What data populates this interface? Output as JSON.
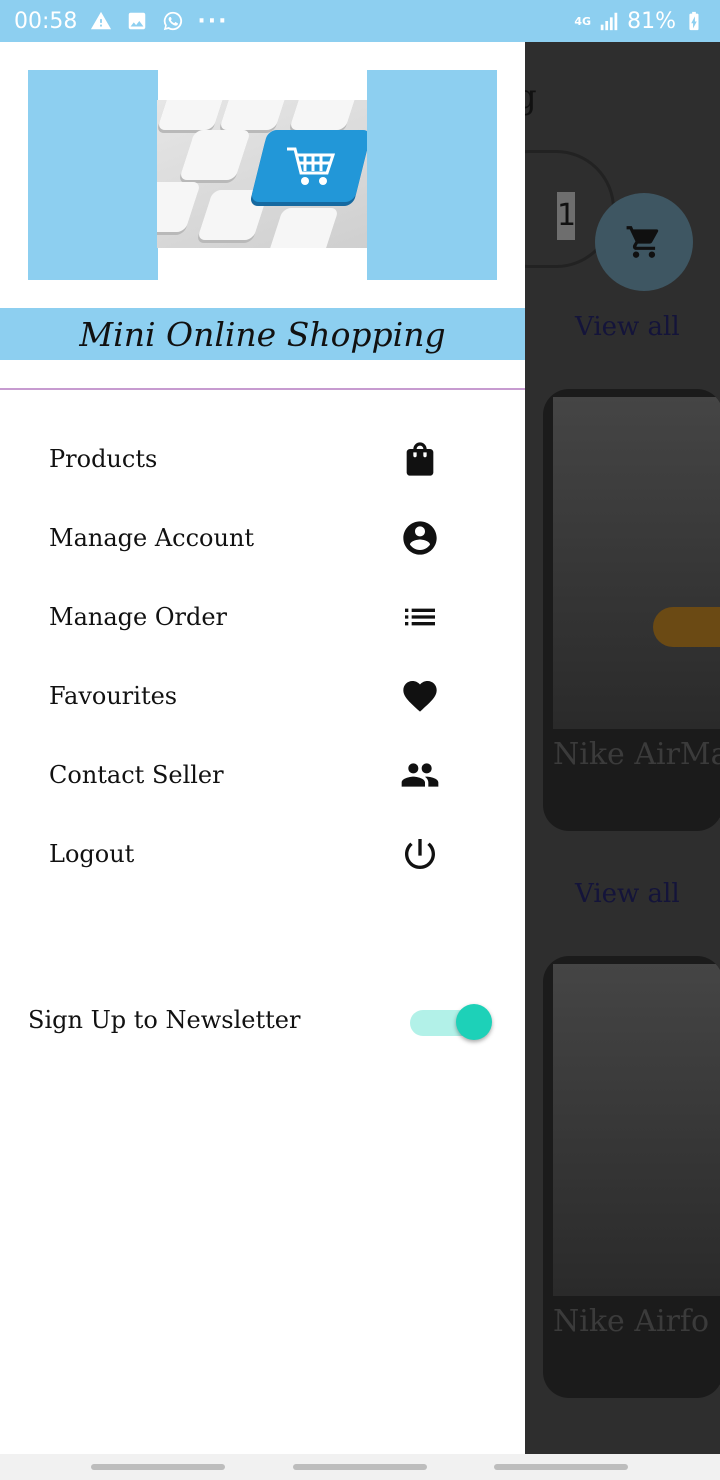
{
  "status_bar": {
    "time": "00:58",
    "left_icons": [
      "warning-icon",
      "image-icon",
      "whatsapp-icon"
    ],
    "more": "···",
    "network": "4G",
    "battery": "81%",
    "battery_state": "charging",
    "background_color": "#8dcff0"
  },
  "background_screen": {
    "title_fragment": "g",
    "cart_quantity": "1",
    "view_all_1": "View all",
    "view_all_2": "View all",
    "product_1": "Nike AirMa",
    "product_2": "Nike Airfo"
  },
  "drawer": {
    "header_image": "shopping-cart-keyboard-image",
    "app_title": "Mini Online Shopping",
    "accent_color": "#8dcff0",
    "menu": [
      {
        "label": "Products",
        "icon": "shopping-bag-icon"
      },
      {
        "label": "Manage Account",
        "icon": "account-circle-icon"
      },
      {
        "label": "Manage Order",
        "icon": "list-icon"
      },
      {
        "label": "Favourites",
        "icon": "heart-icon"
      },
      {
        "label": "Contact Seller",
        "icon": "people-icon"
      },
      {
        "label": "Logout",
        "icon": "power-icon"
      }
    ],
    "newsletter": {
      "label": "Sign Up to Newsletter",
      "enabled": true,
      "toggle_color": "#1dd1b8"
    }
  }
}
